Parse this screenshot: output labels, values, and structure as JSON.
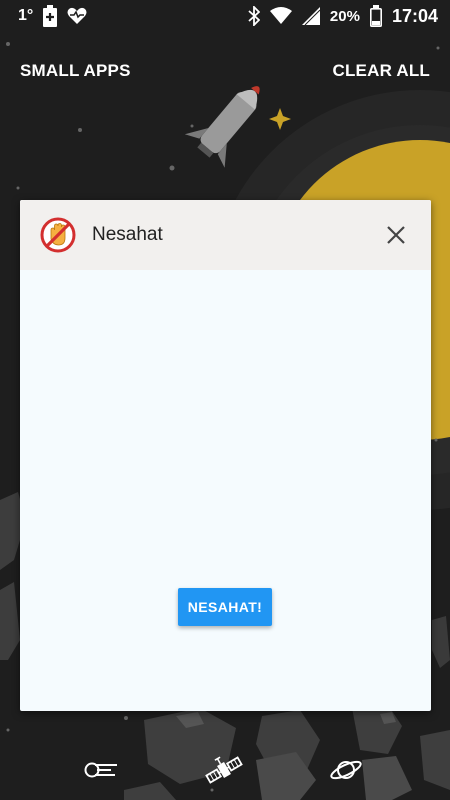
{
  "status_bar": {
    "temperature": "1°",
    "battery_percent": "20%",
    "time": "17:04",
    "icons": [
      "battery-charging-icon",
      "heart-pulse-icon",
      "bluetooth-icon",
      "wifi-icon",
      "signal-icon",
      "battery-icon"
    ]
  },
  "header": {
    "small_apps_label": "SMALL APPS",
    "clear_all_label": "CLEAR ALL"
  },
  "app_card": {
    "app_name": "Nesahat",
    "icon": "no-hand-icon",
    "button_label": "NESAHAT!",
    "accent_color": "#2196f3"
  },
  "bottom_nav": {
    "icons": [
      "comet-icon",
      "satellite-icon",
      "planet-icon"
    ]
  }
}
